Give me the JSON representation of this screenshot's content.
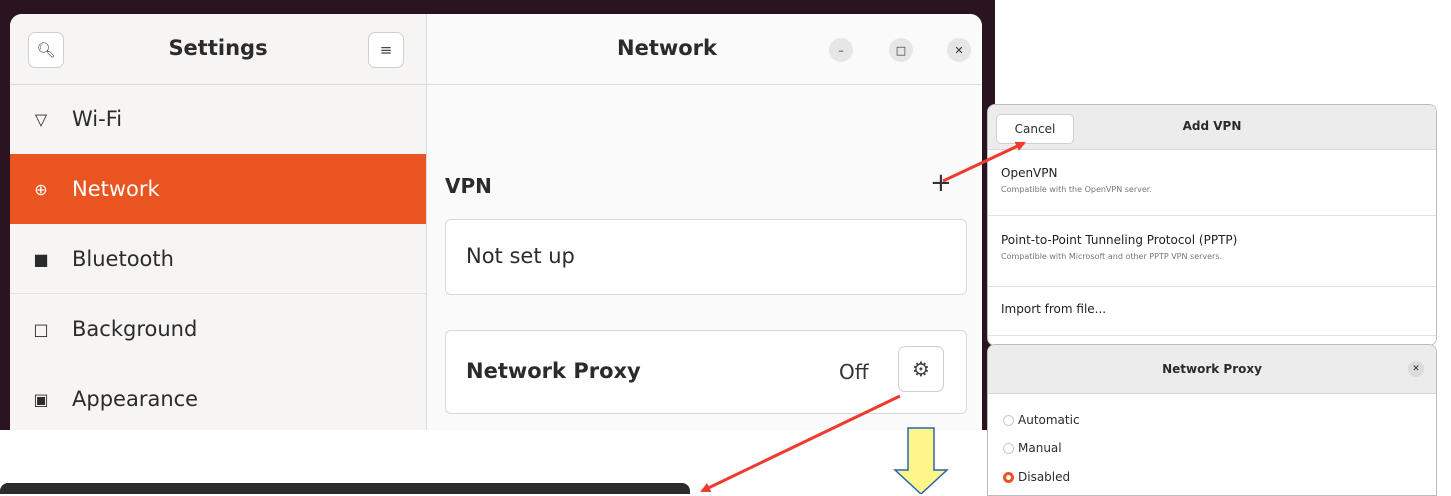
{
  "settings_window": {
    "sidebar": {
      "title": "Settings",
      "search_icon": "search-icon",
      "menu_icon": "hamburger-menu-icon",
      "items": [
        {
          "label": "Wi-Fi",
          "icon": "wifi-icon",
          "active": false
        },
        {
          "label": "Network",
          "icon": "network-globe-icon",
          "active": true
        },
        {
          "label": "Bluetooth",
          "icon": "bluetooth-icon",
          "active": false
        },
        {
          "label": "Background",
          "icon": "monitor-icon",
          "active": false
        },
        {
          "label": "Appearance",
          "icon": "appearance-icon",
          "active": false
        }
      ]
    },
    "main": {
      "title": "Network",
      "vpn_section_label": "VPN",
      "vpn_add_symbol": "+",
      "vpn_status": "Not set up",
      "proxy_label": "Network Proxy",
      "proxy_status": "Off"
    }
  },
  "add_vpn_dialog": {
    "title": "Add VPN",
    "cancel_label": "Cancel",
    "options": [
      {
        "title": "OpenVPN",
        "description": "Compatible with the OpenVPN server."
      },
      {
        "title": "Point-to-Point Tunneling Protocol (PPTP)",
        "description": "Compatible with Microsoft and other PPTP VPN servers."
      },
      {
        "title": "Import from file...",
        "description": ""
      }
    ]
  },
  "network_proxy_dialog": {
    "title": "Network Proxy",
    "options": [
      {
        "label": "Automatic",
        "selected": false
      },
      {
        "label": "Manual",
        "selected": false
      },
      {
        "label": "Disabled",
        "selected": true
      }
    ]
  },
  "colors": {
    "accent": "#e95420",
    "annotation_arrow": "#f03a2e",
    "annotation_callout": "#fff68a"
  }
}
